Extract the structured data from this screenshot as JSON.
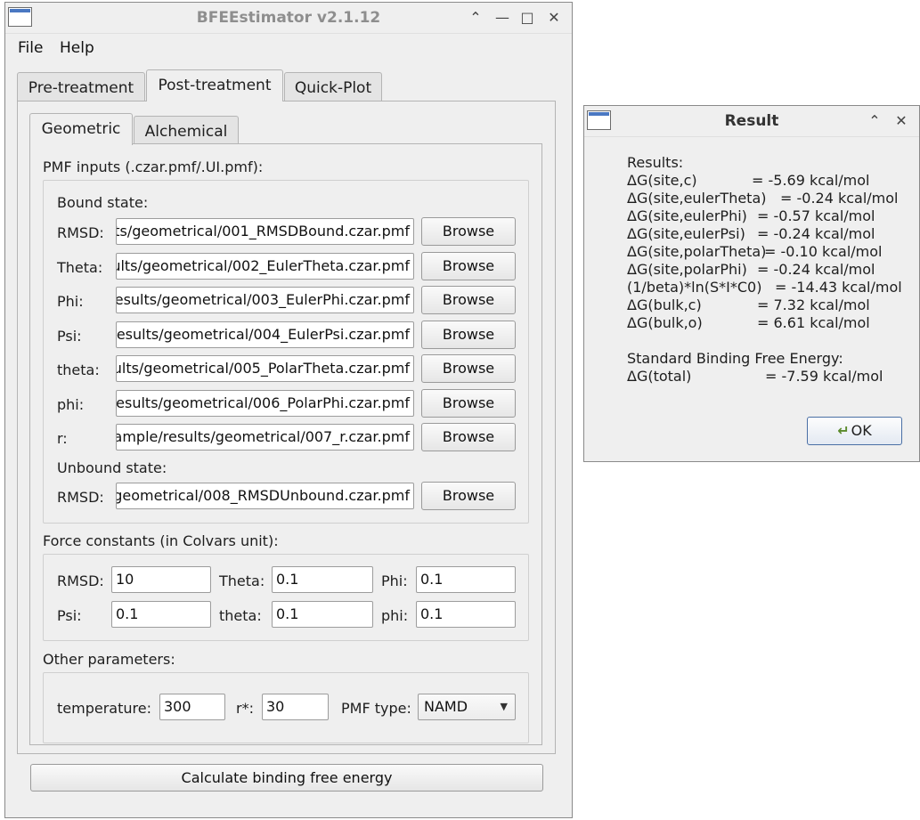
{
  "main_window": {
    "title": "BFEEstimator v2.1.12",
    "menu": [
      "File",
      "Help"
    ],
    "tabs": [
      "Pre-treatment",
      "Post-treatment",
      "Quick-Plot"
    ],
    "subtabs": [
      "Geometric",
      "Alchemical"
    ],
    "pmf_inputs_label": "PMF inputs (.czar.pmf/.UI.pmf):",
    "bound_state_label": "Bound state:",
    "bound_rows": [
      {
        "label": "RMSD:",
        "value": "ts/geometrical/001_RMSDBound.czar.pmf"
      },
      {
        "label": "Theta:",
        "value": "ults/geometrical/002_EulerTheta.czar.pmf"
      },
      {
        "label": "Phi:",
        "value": "esults/geometrical/003_EulerPhi.czar.pmf"
      },
      {
        "label": "Psi:",
        "value": "esults/geometrical/004_EulerPsi.czar.pmf"
      },
      {
        "label": "theta:",
        "value": "ults/geometrical/005_PolarTheta.czar.pmf"
      },
      {
        "label": "phi:",
        "value": "esults/geometrical/006_PolarPhi.czar.pmf"
      },
      {
        "label": "r:",
        "value": "ample/results/geometrical/007_r.czar.pmf"
      }
    ],
    "unbound_state_label": "Unbound state:",
    "unbound_rows": [
      {
        "label": "RMSD:",
        "value": "geometrical/008_RMSDUnbound.czar.pmf"
      }
    ],
    "browse_label": "Browse",
    "force_constants_label": "Force constants (in Colvars unit):",
    "force_constants": {
      "rmsd_label": "RMSD:",
      "rmsd_value": "10",
      "theta_label": "Theta:",
      "theta_value": "0.1",
      "phi_label": "Phi:",
      "phi_value": "0.1",
      "psi_label": "Psi:",
      "psi_value": "0.1",
      "theta2_label": "theta:",
      "theta2_value": "0.1",
      "phi2_label": "phi:",
      "phi2_value": "0.1"
    },
    "other_params_label": "Other parameters:",
    "other_params": {
      "temperature_label": "temperature:",
      "temperature_value": "300",
      "rstar_label": "r*:",
      "rstar_value": "30",
      "pmf_type_label": "PMF type:",
      "pmf_type_value": "NAMD"
    },
    "calculate_label": "Calculate binding free energy"
  },
  "result_window": {
    "title": "Result",
    "heading": "Results:",
    "rows": [
      {
        "key": "ΔG(site,c)",
        "value": "= -5.69 kcal/mol"
      },
      {
        "key": "ΔG(site,eulerTheta)",
        "value": "= -0.24 kcal/mol"
      },
      {
        "key": "ΔG(site,eulerPhi)",
        "value": "= -0.57 kcal/mol"
      },
      {
        "key": "ΔG(site,eulerPsi)",
        "value": "= -0.24 kcal/mol"
      },
      {
        "key": "ΔG(site,polarTheta)",
        "value": "= -0.10 kcal/mol"
      },
      {
        "key": "ΔG(site,polarPhi)",
        "value": "= -0.24 kcal/mol"
      },
      {
        "key": "(1/beta)*ln(S*I*C0)",
        "value": "= -14.43 kcal/mol"
      },
      {
        "key": "ΔG(bulk,c)",
        "value": "= 7.32 kcal/mol"
      },
      {
        "key": "ΔG(bulk,o)",
        "value": "= 6.61 kcal/mol"
      }
    ],
    "standard_heading": "Standard Binding Free Energy:",
    "total_key": "ΔG(total)",
    "total_value": "= -7.59 kcal/mol",
    "ok_label": "OK"
  }
}
